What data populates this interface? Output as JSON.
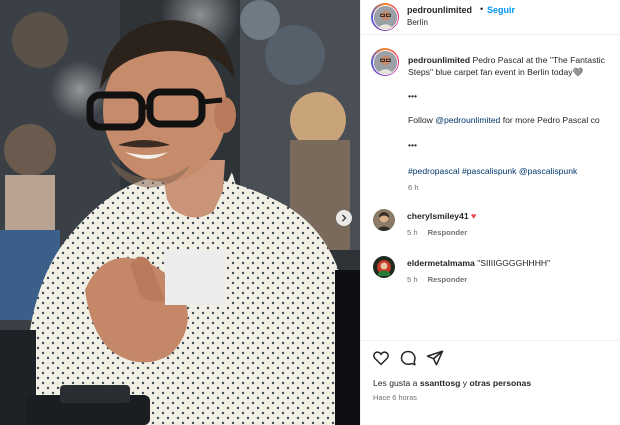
{
  "post": {
    "username": "pedrounlimited",
    "separator": "•",
    "follow_label": "Seguir",
    "location": "Berlín"
  },
  "caption": {
    "username": "pedrounlimited",
    "text": " Pedro Pascal at the \"The Fantastic",
    "text_line2": "Steps\" blue carpet fan event in Berlin today",
    "heart": "🩶",
    "dots1": "•••",
    "follow_prefix": "Follow ",
    "follow_mention": "@pedrounlimited",
    "follow_suffix": " for more Pedro Pascal co",
    "dots2": "•••",
    "tag1": "#pedropascal",
    "tag2": "#pascalispunk",
    "tag3": "@pascalispunk",
    "time": "6 h"
  },
  "comments": [
    {
      "username": "cherylsmiley41",
      "text": "",
      "emoji": "♥",
      "time": "5 h",
      "reply": "Responder"
    },
    {
      "username": "eldermetalmama",
      "text": "\"SIIIIGGGGHHHH\"",
      "time": "5 h",
      "reply": "Responder"
    }
  ],
  "actions": {
    "like_icon": "heart-outline-icon",
    "comment_icon": "comment-icon",
    "share_icon": "share-icon"
  },
  "likes": {
    "prefix": "Les gusta a ",
    "user": "ssanttosg",
    "middle": " y ",
    "others": "otras personas"
  },
  "posted_ago": "Hace 6 horas",
  "colors": {
    "link_blue": "#0095f6",
    "mention_blue": "#00376b",
    "muted": "#737373",
    "text": "#262626"
  }
}
